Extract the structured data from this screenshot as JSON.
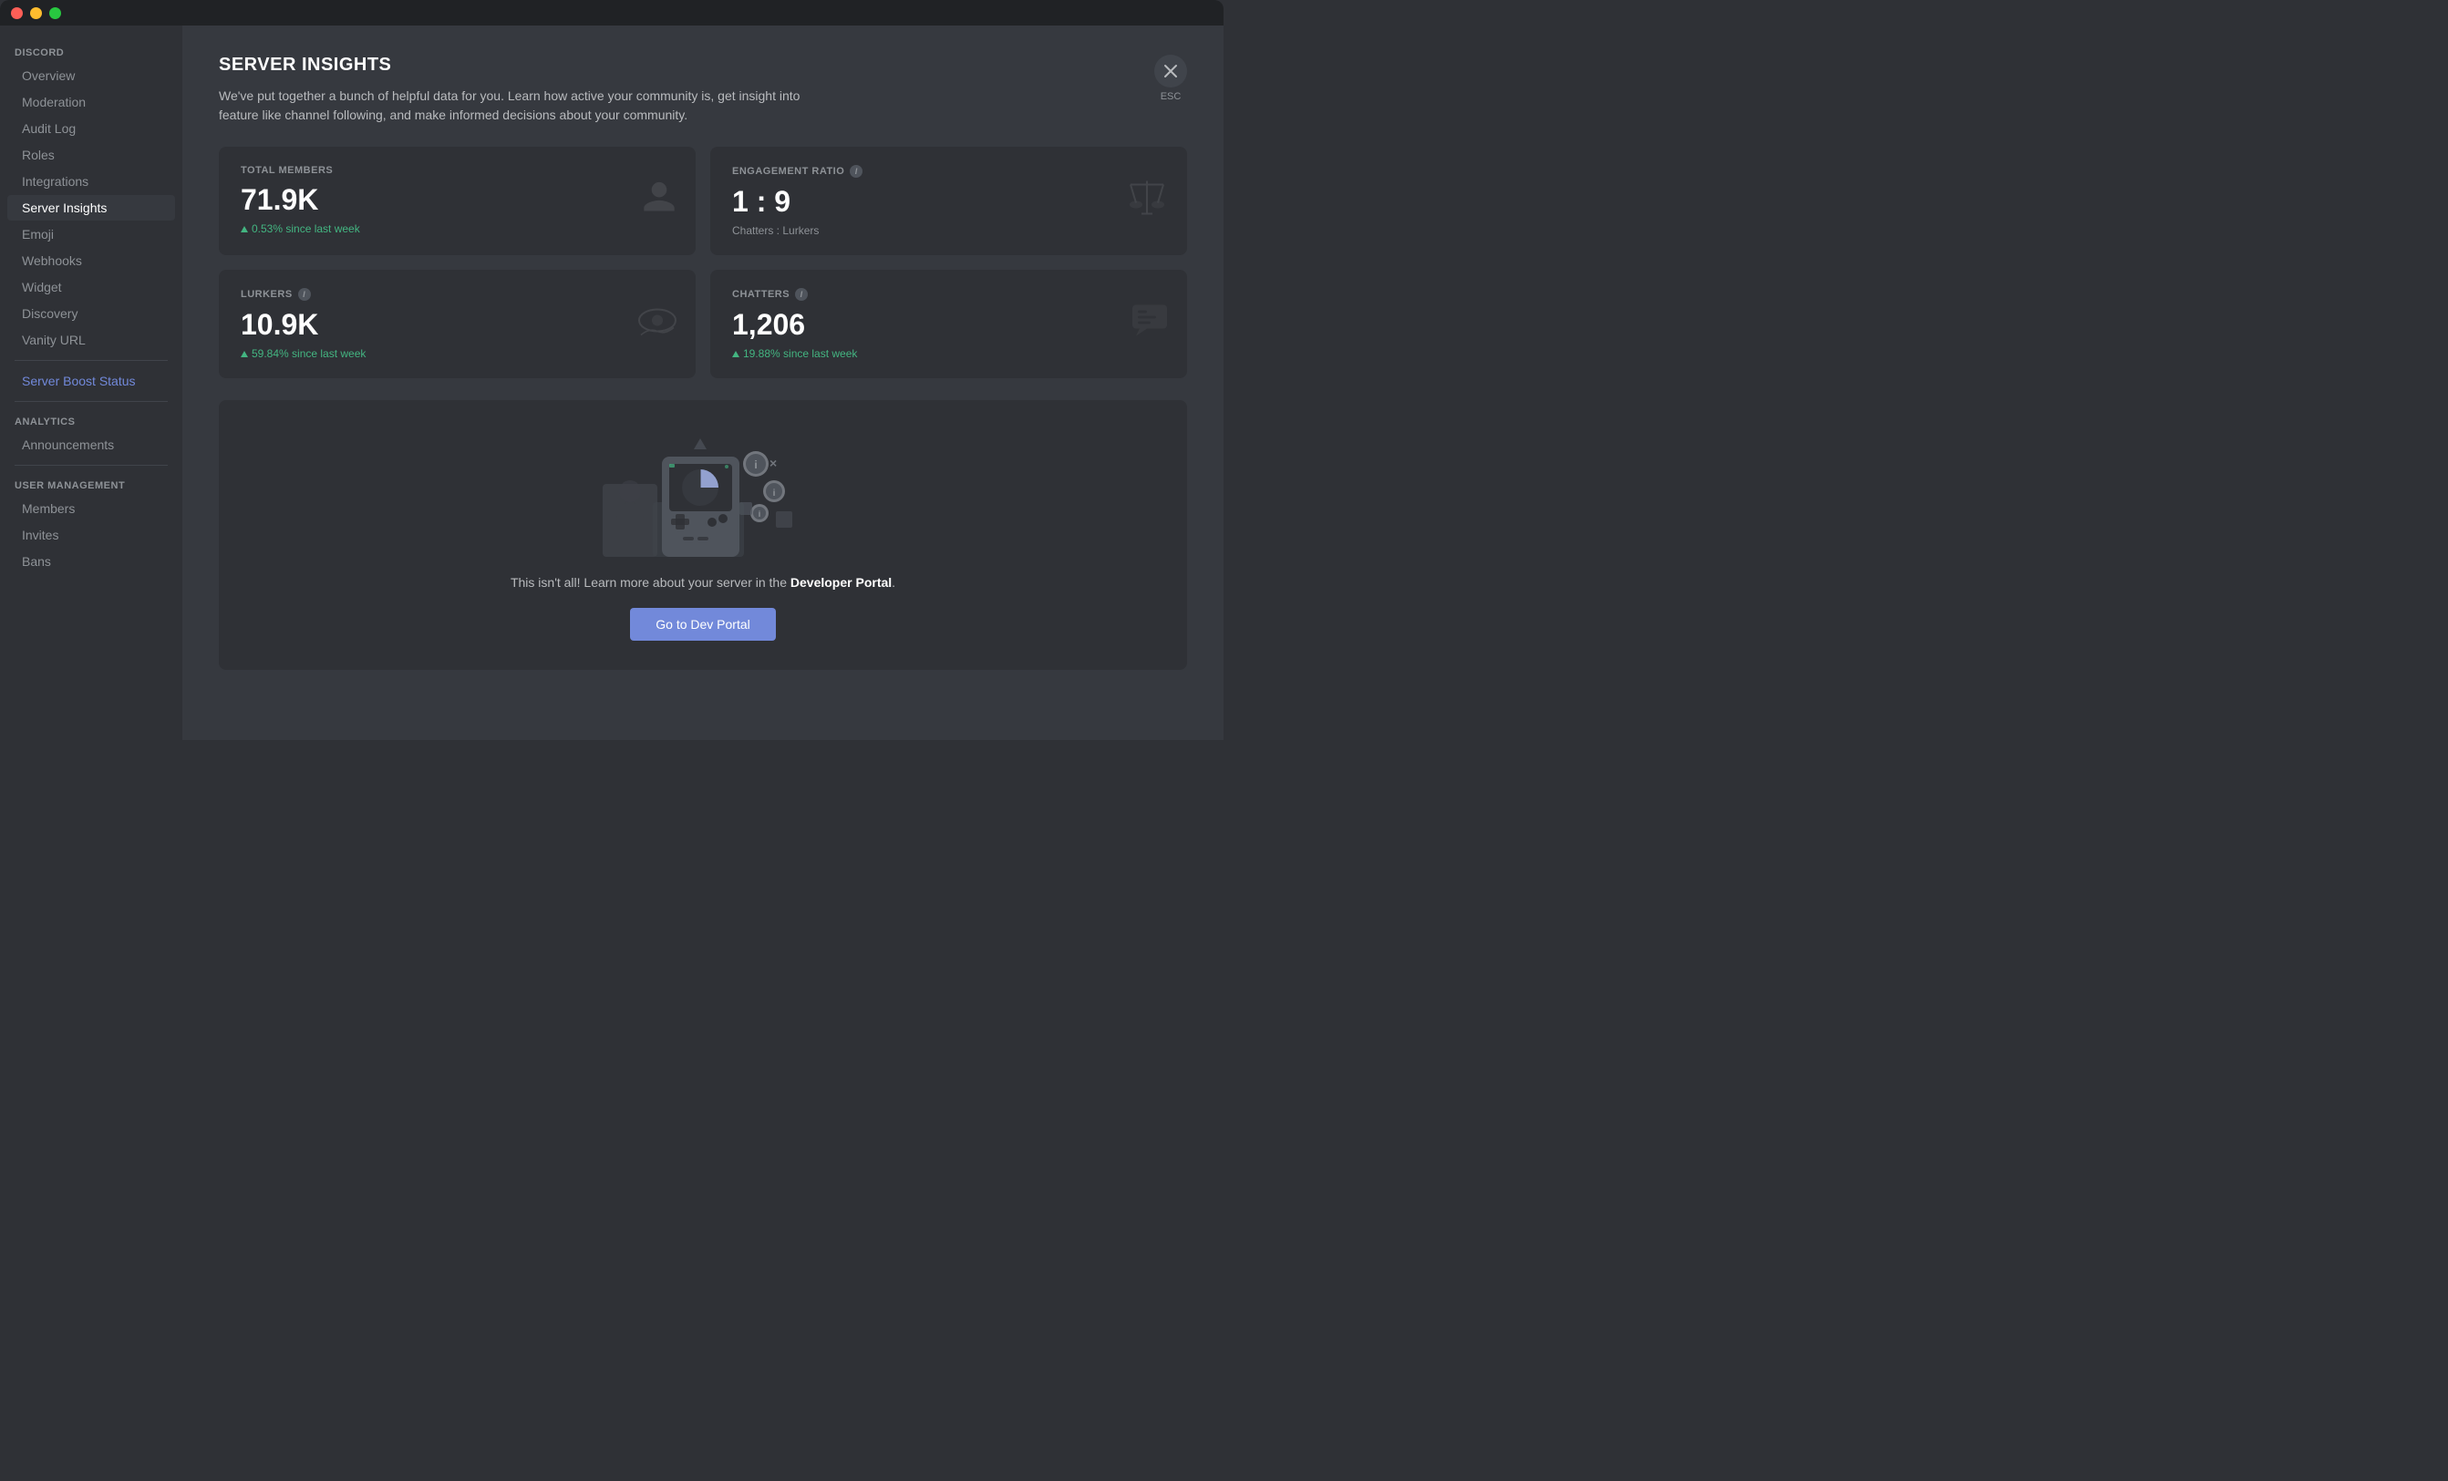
{
  "titlebar": {
    "close": "close",
    "minimize": "minimize",
    "maximize": "maximize"
  },
  "sidebar": {
    "section_discord": "DISCORD",
    "section_analytics": "ANALYTICS",
    "section_user_management": "USER MANAGEMENT",
    "items": [
      {
        "id": "overview",
        "label": "Overview",
        "active": false
      },
      {
        "id": "moderation",
        "label": "Moderation",
        "active": false
      },
      {
        "id": "audit-log",
        "label": "Audit Log",
        "active": false
      },
      {
        "id": "roles",
        "label": "Roles",
        "active": false
      },
      {
        "id": "integrations",
        "label": "Integrations",
        "active": false
      },
      {
        "id": "server-insights",
        "label": "Server Insights",
        "active": true
      },
      {
        "id": "emoji",
        "label": "Emoji",
        "active": false
      },
      {
        "id": "webhooks",
        "label": "Webhooks",
        "active": false
      },
      {
        "id": "widget",
        "label": "Widget",
        "active": false
      },
      {
        "id": "discovery",
        "label": "Discovery",
        "active": false
      },
      {
        "id": "vanity-url",
        "label": "Vanity URL",
        "active": false
      },
      {
        "id": "server-boost-status",
        "label": "Server Boost Status",
        "active": false,
        "highlight": true
      },
      {
        "id": "announcements",
        "label": "Announcements",
        "active": false
      },
      {
        "id": "members",
        "label": "Members",
        "active": false
      },
      {
        "id": "invites",
        "label": "Invites",
        "active": false
      },
      {
        "id": "bans",
        "label": "Bans",
        "active": false
      }
    ]
  },
  "main": {
    "title": "SERVER INSIGHTS",
    "description": "We've put together a bunch of helpful data for you. Learn how active your community is, get insight into feature like channel following, and make informed decisions about your community.",
    "close_label": "ESC",
    "stats": [
      {
        "id": "total-members",
        "label": "TOTAL MEMBERS",
        "has_info": false,
        "value": "71.9K",
        "change": "0.53% since last week",
        "icon": "person"
      },
      {
        "id": "engagement-ratio",
        "label": "ENGAGEMENT RATIO",
        "has_info": true,
        "value": "1 : 9",
        "sub": "Chatters : Lurkers",
        "icon": "scale"
      },
      {
        "id": "lurkers",
        "label": "LURKERS",
        "has_info": true,
        "value": "10.9K",
        "change": "59.84% since last week",
        "icon": "eye"
      },
      {
        "id": "chatters",
        "label": "CHATTERS",
        "has_info": true,
        "value": "1,206",
        "change": "19.88% since last week",
        "icon": "chat"
      }
    ],
    "dev_portal": {
      "text_before": "This isn't all! Learn more about your server in the ",
      "text_link": "Developer Portal",
      "text_after": ".",
      "button_label": "Go to Dev Portal"
    }
  }
}
